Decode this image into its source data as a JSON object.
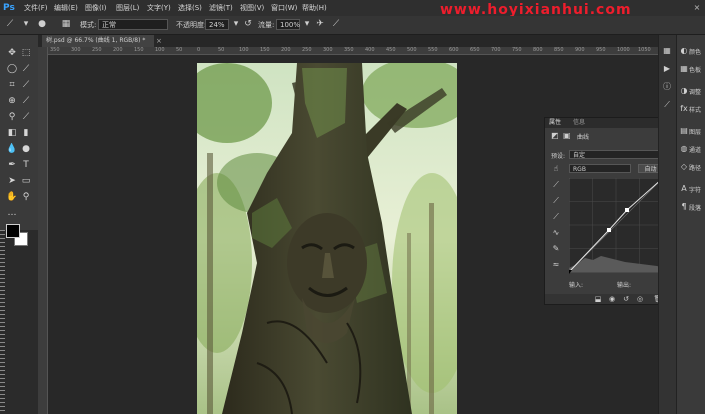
{
  "app": {
    "logo": "Ps"
  },
  "menu": [
    "文件(F)",
    "编辑(E)",
    "图像(I)",
    "图层(L)",
    "文字(Y)",
    "选择(S)",
    "滤镜(T)",
    "视图(V)",
    "窗口(W)",
    "帮助(H)"
  ],
  "watermark": "www.hoyixianhui.com",
  "options": {
    "mode_label": "模式:",
    "mode_value": "正常",
    "opacity_label": "不透明度:",
    "opacity_value": "24%",
    "flow_label": "流量:",
    "flow_value": "100%"
  },
  "document": {
    "tab_title": "树.psd @ 66.7% (曲线 1, RGB/8) *",
    "tab_close": "×"
  },
  "ruler": {
    "ticks": [
      "350",
      "300",
      "250",
      "200",
      "150",
      "100",
      "50",
      "0",
      "50",
      "100",
      "150",
      "200",
      "250",
      "300",
      "350",
      "400",
      "450",
      "500",
      "550",
      "600",
      "650",
      "700",
      "750",
      "800",
      "850",
      "900",
      "950",
      "1000",
      "1050"
    ]
  },
  "curves_panel": {
    "tab_properties": "属性",
    "tab_info": "信息",
    "type_label": "曲线",
    "preset_label": "预设:",
    "preset_value": "自定",
    "channel_value": "RGB",
    "auto_button": "自动",
    "input_label": "输入:",
    "output_label": "输出:",
    "auto_icon": "auto-icon"
  },
  "right_dock": {
    "labels": [
      "颜色",
      "色板",
      "调整",
      "样式",
      "图层",
      "通道",
      "路径",
      "字符",
      "段落"
    ]
  },
  "colors": {
    "foreground": "#000000",
    "background": "#ffffff",
    "accent_ps": "#39a3ff",
    "watermark": "#ee1d2c"
  }
}
